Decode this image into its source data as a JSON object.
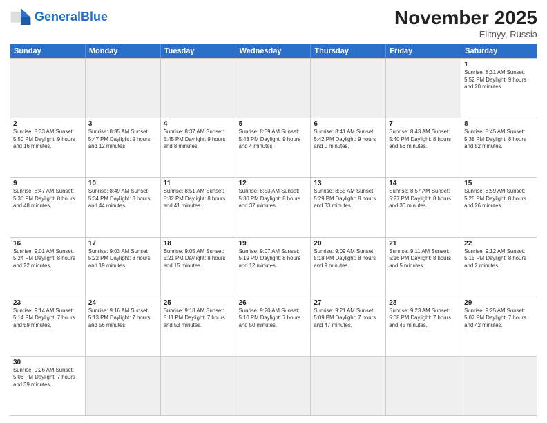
{
  "logo": {
    "general": "General",
    "blue": "Blue"
  },
  "title": "November 2025",
  "location": "Elitnyy, Russia",
  "days_header": [
    "Sunday",
    "Monday",
    "Tuesday",
    "Wednesday",
    "Thursday",
    "Friday",
    "Saturday"
  ],
  "weeks": [
    [
      {
        "day": "",
        "info": "",
        "empty": true
      },
      {
        "day": "",
        "info": "",
        "empty": true
      },
      {
        "day": "",
        "info": "",
        "empty": true
      },
      {
        "day": "",
        "info": "",
        "empty": true
      },
      {
        "day": "",
        "info": "",
        "empty": true
      },
      {
        "day": "",
        "info": "",
        "empty": true
      },
      {
        "day": "1",
        "info": "Sunrise: 8:31 AM\nSunset: 5:52 PM\nDaylight: 9 hours and 20 minutes."
      }
    ],
    [
      {
        "day": "2",
        "info": "Sunrise: 8:33 AM\nSunset: 5:50 PM\nDaylight: 9 hours and 16 minutes."
      },
      {
        "day": "3",
        "info": "Sunrise: 8:35 AM\nSunset: 5:47 PM\nDaylight: 9 hours and 12 minutes."
      },
      {
        "day": "4",
        "info": "Sunrise: 8:37 AM\nSunset: 5:45 PM\nDaylight: 9 hours and 8 minutes."
      },
      {
        "day": "5",
        "info": "Sunrise: 8:39 AM\nSunset: 5:43 PM\nDaylight: 9 hours and 4 minutes."
      },
      {
        "day": "6",
        "info": "Sunrise: 8:41 AM\nSunset: 5:42 PM\nDaylight: 9 hours and 0 minutes."
      },
      {
        "day": "7",
        "info": "Sunrise: 8:43 AM\nSunset: 5:40 PM\nDaylight: 8 hours and 56 minutes."
      },
      {
        "day": "8",
        "info": "Sunrise: 8:45 AM\nSunset: 5:38 PM\nDaylight: 8 hours and 52 minutes."
      }
    ],
    [
      {
        "day": "9",
        "info": "Sunrise: 8:47 AM\nSunset: 5:36 PM\nDaylight: 8 hours and 48 minutes."
      },
      {
        "day": "10",
        "info": "Sunrise: 8:49 AM\nSunset: 5:34 PM\nDaylight: 8 hours and 44 minutes."
      },
      {
        "day": "11",
        "info": "Sunrise: 8:51 AM\nSunset: 5:32 PM\nDaylight: 8 hours and 41 minutes."
      },
      {
        "day": "12",
        "info": "Sunrise: 8:53 AM\nSunset: 5:30 PM\nDaylight: 8 hours and 37 minutes."
      },
      {
        "day": "13",
        "info": "Sunrise: 8:55 AM\nSunset: 5:29 PM\nDaylight: 8 hours and 33 minutes."
      },
      {
        "day": "14",
        "info": "Sunrise: 8:57 AM\nSunset: 5:27 PM\nDaylight: 8 hours and 30 minutes."
      },
      {
        "day": "15",
        "info": "Sunrise: 8:59 AM\nSunset: 5:25 PM\nDaylight: 8 hours and 26 minutes."
      }
    ],
    [
      {
        "day": "16",
        "info": "Sunrise: 9:01 AM\nSunset: 5:24 PM\nDaylight: 8 hours and 22 minutes."
      },
      {
        "day": "17",
        "info": "Sunrise: 9:03 AM\nSunset: 5:22 PM\nDaylight: 8 hours and 19 minutes."
      },
      {
        "day": "18",
        "info": "Sunrise: 9:05 AM\nSunset: 5:21 PM\nDaylight: 8 hours and 15 minutes."
      },
      {
        "day": "19",
        "info": "Sunrise: 9:07 AM\nSunset: 5:19 PM\nDaylight: 8 hours and 12 minutes."
      },
      {
        "day": "20",
        "info": "Sunrise: 9:09 AM\nSunset: 5:18 PM\nDaylight: 8 hours and 9 minutes."
      },
      {
        "day": "21",
        "info": "Sunrise: 9:11 AM\nSunset: 5:16 PM\nDaylight: 8 hours and 5 minutes."
      },
      {
        "day": "22",
        "info": "Sunrise: 9:12 AM\nSunset: 5:15 PM\nDaylight: 8 hours and 2 minutes."
      }
    ],
    [
      {
        "day": "23",
        "info": "Sunrise: 9:14 AM\nSunset: 5:14 PM\nDaylight: 7 hours and 59 minutes."
      },
      {
        "day": "24",
        "info": "Sunrise: 9:16 AM\nSunset: 5:13 PM\nDaylight: 7 hours and 56 minutes."
      },
      {
        "day": "25",
        "info": "Sunrise: 9:18 AM\nSunset: 5:11 PM\nDaylight: 7 hours and 53 minutes."
      },
      {
        "day": "26",
        "info": "Sunrise: 9:20 AM\nSunset: 5:10 PM\nDaylight: 7 hours and 50 minutes."
      },
      {
        "day": "27",
        "info": "Sunrise: 9:21 AM\nSunset: 5:09 PM\nDaylight: 7 hours and 47 minutes."
      },
      {
        "day": "28",
        "info": "Sunrise: 9:23 AM\nSunset: 5:08 PM\nDaylight: 7 hours and 45 minutes."
      },
      {
        "day": "29",
        "info": "Sunrise: 9:25 AM\nSunset: 5:07 PM\nDaylight: 7 hours and 42 minutes."
      }
    ],
    [
      {
        "day": "30",
        "info": "Sunrise: 9:26 AM\nSunset: 5:06 PM\nDaylight: 7 hours and 39 minutes."
      },
      {
        "day": "",
        "info": "",
        "empty": true
      },
      {
        "day": "",
        "info": "",
        "empty": true
      },
      {
        "day": "",
        "info": "",
        "empty": true
      },
      {
        "day": "",
        "info": "",
        "empty": true
      },
      {
        "day": "",
        "info": "",
        "empty": true
      },
      {
        "day": "",
        "info": "",
        "empty": true
      }
    ]
  ]
}
